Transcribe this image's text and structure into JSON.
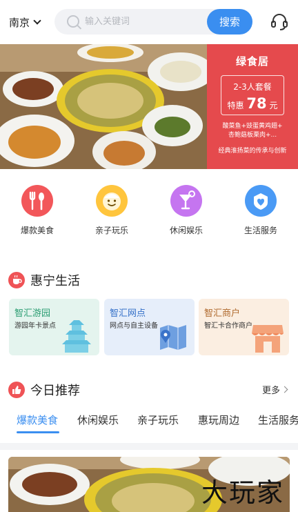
{
  "header": {
    "city": "南京",
    "search_placeholder": "输入关键词",
    "search_button": "搜索"
  },
  "banner": {
    "brand": "绿食居",
    "deal_title": "2-3人套餐",
    "price_prefix": "特惠",
    "price": "78",
    "price_unit": "元",
    "items_line1": "酸菜鱼+豉蛋黄鸡翅+",
    "items_line2": "杏鲍菇板栗肉+...",
    "slogan": "经典淮扬菜的传承与创新"
  },
  "categories": [
    {
      "label": "爆款美食",
      "color": "#f2575a",
      "icon": "fork-spoon-icon"
    },
    {
      "label": "亲子玩乐",
      "color": "#ffc53d",
      "icon": "smiley-face-icon"
    },
    {
      "label": "休闲娱乐",
      "color": "#c575f0",
      "icon": "cocktail-icon"
    },
    {
      "label": "生活服务",
      "color": "#4a9af5",
      "icon": "heart-icon"
    }
  ],
  "section1": {
    "title": "惠宁生活"
  },
  "cards": [
    {
      "title": "智汇游园",
      "sub": "游园年卡景点",
      "title_color": "#2a9d72",
      "bg": "#e4f4ee"
    },
    {
      "title": "智汇网点",
      "sub": "网点与自主设备",
      "title_color": "#3470c8",
      "bg": "#e6eefa"
    },
    {
      "title": "智汇商户",
      "sub": "智汇卡合作商户",
      "title_color": "#b06a2e",
      "bg": "#fbeee1"
    }
  ],
  "section2": {
    "title": "今日推荐",
    "more": "更多"
  },
  "tabs": [
    "爆款美食",
    "休闲娱乐",
    "亲子玩乐",
    "惠玩周边",
    "生活服务"
  ],
  "watermark": "大玩家"
}
